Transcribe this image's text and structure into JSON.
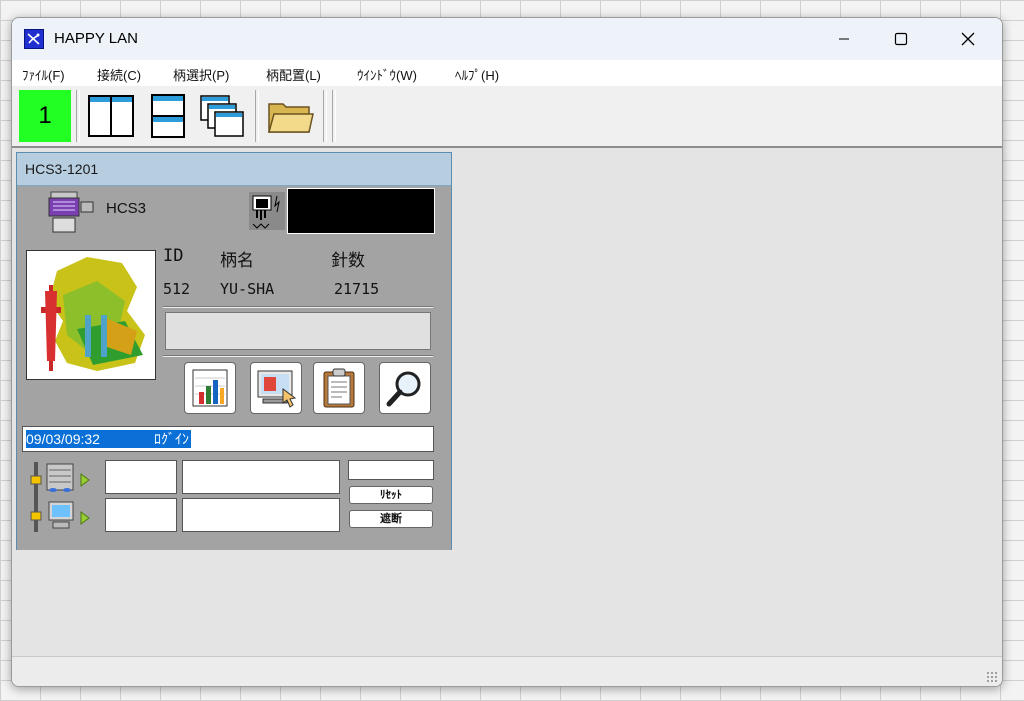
{
  "window": {
    "title": "HAPPY LAN"
  },
  "menu": [
    {
      "label": "ﾌｧｲﾙ(F)"
    },
    {
      "label": "接続(C)"
    },
    {
      "label": "柄選択(P)"
    },
    {
      "label": "柄配置(L)"
    },
    {
      "label": "ｳｲﾝﾄﾞｳ(W)"
    },
    {
      "label": "ﾍﾙﾌﾟ(H)"
    }
  ],
  "toolbar": {
    "machine_number": "1",
    "indicator_color": "#22ff22",
    "buttons": [
      "tile-vertical-icon",
      "tile-horizontal-icon",
      "cascade-icon",
      "folder-open-icon"
    ]
  },
  "machine_window": {
    "title": "HCS3-1201",
    "machine_model": "HCS3",
    "headers": {
      "id": "ID",
      "pattern_name": "柄名",
      "stitch_count": "針数"
    },
    "values": {
      "id": "512",
      "pattern_name": "YU-SHA",
      "stitch_count": "21715"
    },
    "log": {
      "timestamp": "09/03/09:32",
      "event": "ﾛｸﾞｲﾝ",
      "highlight_color": "#0a6fd6"
    },
    "buttons": {
      "reset": "ﾘｾｯﾄ",
      "cutoff": "遮断"
    },
    "icon_buttons": [
      "bar-chart-icon",
      "pattern-monitor-icon",
      "clipboard-icon",
      "magnifier-icon"
    ]
  }
}
